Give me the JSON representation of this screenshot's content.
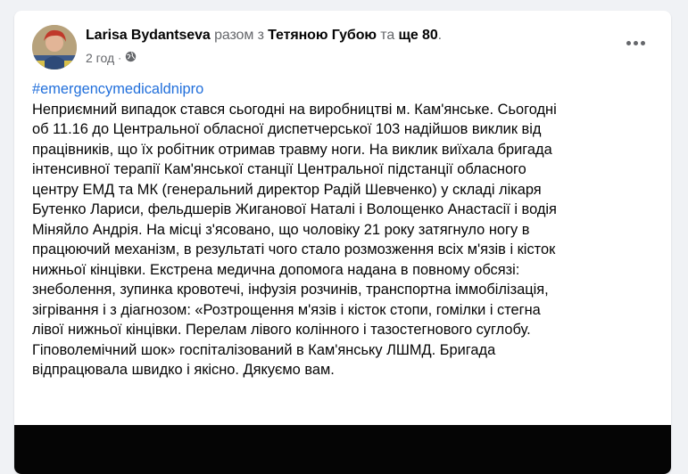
{
  "post": {
    "author": "Larisa Bydantseva",
    "with_text": " разом з ",
    "tagged": "Тетяною Губою",
    "and_text": " та ",
    "others": "ще 80",
    "end_punct": ".",
    "time": "2 год",
    "dot": "·",
    "privacy_icon": "globe-icon",
    "more_icon": "more-options-icon",
    "hashtag": "#emergencymedicaldnipro",
    "lines": [
      "Неприємний випадок стався сьогодні на виробництві м. Кам'янське. Сьогодні",
      "об 11.16 до Центральної обласної диспетчерської 103  надійшов виклик від",
      "працівників, що їх робітник отримав травму ноги.  На виклик виїхала бригада",
      "інтенсивної терапії  Кам'янської станції Центральної підстанції  обласного",
      "центру ЕМД та МК (генеральний директор Радій Шевченко) у складі лікаря",
      "Бутенко Лариси, фельдшерів Жиганової Наталі і Волощенко Анастасії і водія",
      "Міняйло Андрія. На місці з'ясовано, що чоловіку 21 року затягнуло ногу в",
      "працюючий механізм, в результаті чого стало розмозження всіх м'язів і кісток",
      "нижньої кінцівки. Екстрена медична допомога надана в повному обсязі:",
      "знеболення, зупинка кровотечі, інфузія розчинів, транспортна іммобілізація,",
      "зігрівання і з діагнозом: «Розтрощення м'язів і кісток стопи, гомілки і стегна",
      "лівої нижньої кінцівки. Перелам лівого колінного і тазостегнового суглобу.",
      "Гіповолемічний шок» госпіталізований в Кам'янську ЛШМД. Бригада",
      "відпрацювала швидко і якісно. Дякуємо вам."
    ]
  }
}
